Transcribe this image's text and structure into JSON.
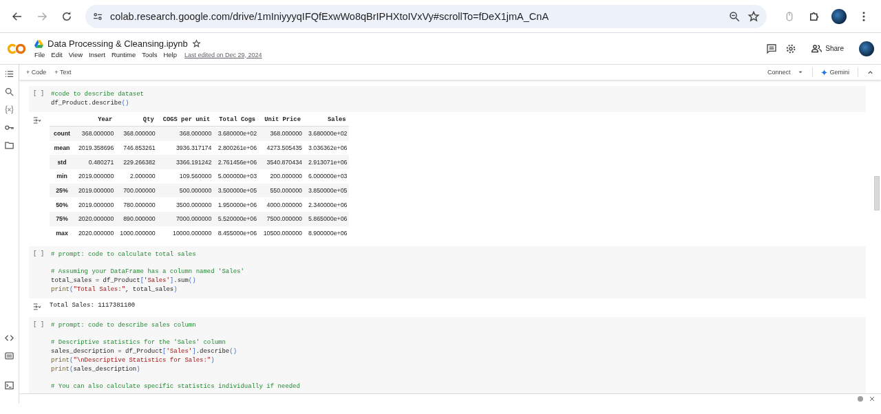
{
  "browser": {
    "url": "colab.research.google.com/drive/1mIniyyyqIFQfExwWo8qBrIPHXtoIVxVy#scrollTo=fDeX1jmA_CnA"
  },
  "notebook": {
    "title": "Data Processing & Cleansing.ipynb",
    "menu": [
      "File",
      "Edit",
      "View",
      "Insert",
      "Runtime",
      "Tools",
      "Help"
    ],
    "last_edited": "Last edited on Dec 29, 2024",
    "share": "Share"
  },
  "toolbar": {
    "add_code": "+ Code",
    "add_text": "+ Text",
    "connect": "Connect",
    "gemini": "Gemini"
  },
  "cells": [
    {
      "bracket": "[ ]",
      "blocks": [
        [
          [
            {
              "kind": "comment",
              "text": "#code to describe dataset"
            }
          ],
          [
            {
              "kind": "plain",
              "text": "df_Product.describe"
            },
            {
              "kind": "paren",
              "text": "()"
            }
          ]
        ]
      ],
      "output": {
        "kind": "table",
        "columns": [
          "Year",
          "Qty",
          "COGS per unit",
          "Total Cogs",
          "Unit Price",
          "Sales"
        ],
        "rows": [
          {
            "index": "count",
            "cells": [
              "368.000000",
              "368.000000",
              "368.000000",
              "3.680000e+02",
              "368.000000",
              "3.680000e+02"
            ]
          },
          {
            "index": "mean",
            "cells": [
              "2019.358696",
              "746.853261",
              "3936.317174",
              "2.800261e+06",
              "4273.505435",
              "3.036362e+06"
            ]
          },
          {
            "index": "std",
            "cells": [
              "0.480271",
              "229.266382",
              "3366.191242",
              "2.761456e+06",
              "3540.870434",
              "2.913071e+06"
            ]
          },
          {
            "index": "min",
            "cells": [
              "2019.000000",
              "2.000000",
              "109.560000",
              "5.000000e+03",
              "200.000000",
              "6.000000e+03"
            ]
          },
          {
            "index": "25%",
            "cells": [
              "2019.000000",
              "700.000000",
              "500.000000",
              "3.500000e+05",
              "550.000000",
              "3.850000e+05"
            ]
          },
          {
            "index": "50%",
            "cells": [
              "2019.000000",
              "780.000000",
              "3500.000000",
              "1.950000e+06",
              "4000.000000",
              "2.340000e+06"
            ]
          },
          {
            "index": "75%",
            "cells": [
              "2020.000000",
              "890.000000",
              "7000.000000",
              "5.520000e+06",
              "7500.000000",
              "5.865000e+06"
            ]
          },
          {
            "index": "max",
            "cells": [
              "2020.000000",
              "1000.000000",
              "10000.000000",
              "8.455000e+06",
              "10500.000000",
              "8.900000e+06"
            ]
          }
        ]
      }
    },
    {
      "bracket": "[ ]",
      "blocks": [
        [
          [
            {
              "kind": "comment",
              "text": "# prompt: code to calculate total sales"
            }
          ]
        ],
        [
          [
            {
              "kind": "comment",
              "text": "# Assuming your DataFrame has a column named 'Sales'"
            }
          ],
          [
            {
              "kind": "plain",
              "text": "total_sales = df_Product"
            },
            {
              "kind": "paren",
              "text": "["
            },
            {
              "kind": "string",
              "text": "'Sales'"
            },
            {
              "kind": "paren",
              "text": "]"
            },
            {
              "kind": "plain",
              "text": ".sum"
            },
            {
              "kind": "paren",
              "text": "()"
            }
          ],
          [
            {
              "kind": "builtin",
              "text": "print"
            },
            {
              "kind": "paren",
              "text": "("
            },
            {
              "kind": "string",
              "text": "\"Total Sales:\""
            },
            {
              "kind": "plain",
              "text": ", total_sales"
            },
            {
              "kind": "paren",
              "text": ")"
            }
          ]
        ]
      ],
      "output": {
        "kind": "text",
        "text": "Total Sales: 1117381100"
      }
    },
    {
      "bracket": "[ ]",
      "blocks": [
        [
          [
            {
              "kind": "comment",
              "text": "# prompt: code to describe sales column"
            }
          ]
        ],
        [
          [
            {
              "kind": "comment",
              "text": "# Descriptive statistics for the 'Sales' column"
            }
          ],
          [
            {
              "kind": "plain",
              "text": "sales_description = df_Product"
            },
            {
              "kind": "paren",
              "text": "["
            },
            {
              "kind": "string",
              "text": "'Sales'"
            },
            {
              "kind": "paren",
              "text": "]"
            },
            {
              "kind": "plain",
              "text": ".describe"
            },
            {
              "kind": "paren",
              "text": "()"
            }
          ],
          [
            {
              "kind": "builtin",
              "text": "print"
            },
            {
              "kind": "paren",
              "text": "("
            },
            {
              "kind": "string",
              "text": "\"\\nDescriptive Statistics for Sales:\""
            },
            {
              "kind": "paren",
              "text": ")"
            }
          ],
          [
            {
              "kind": "builtin",
              "text": "print"
            },
            {
              "kind": "paren",
              "text": "("
            },
            {
              "kind": "plain",
              "text": "sales_description"
            },
            {
              "kind": "paren",
              "text": ")"
            }
          ]
        ],
        [
          [
            {
              "kind": "comment",
              "text": "# You can also calculate specific statistics individually if needed"
            }
          ]
        ]
      ]
    }
  ]
}
